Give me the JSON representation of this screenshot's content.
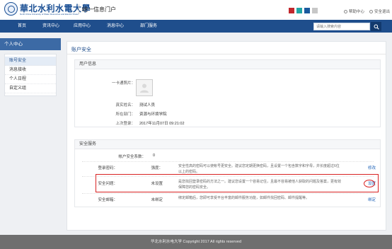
{
  "header": {
    "logo_cn": "華北水利水電大學",
    "logo_en": "North China University of Water Resources and Electric Power",
    "portal_title": "统一信息门户",
    "theme_colors": [
      "#c1272d",
      "#21a6a6",
      "#1a5a9e",
      "#c7c7c7"
    ],
    "help_label": "帮助中心",
    "logout_label": "安全退出"
  },
  "nav": {
    "items": [
      "首页",
      "资讯中心",
      "应用中心",
      "消息中心",
      "部门服务"
    ],
    "search_placeholder": "请输入搜索内容"
  },
  "sidebar": {
    "title": "个人中心",
    "items": [
      "账号安全",
      "消息接收",
      "个人日程",
      "自定义组"
    ],
    "active_index": 0
  },
  "main": {
    "page_title": "账户安全",
    "user_info": {
      "panel_title": "用户信息",
      "photo_label": "一卡通照片：",
      "name_label": "真实姓名：",
      "name_value": "测试人员",
      "dept_label": "所在部门：",
      "dept_value": "资源与环境学院",
      "last_login_label": "上次登录：",
      "last_login_value": "2017年11月07日 09:21:02"
    },
    "security": {
      "panel_title": "安全服务",
      "score_label": "帐户安全系数：",
      "score_value": "0",
      "rows": [
        {
          "label": "登录密码：",
          "status": "强度：",
          "desc": "安全性高的密码可以使帐号更安全。建议您定期更换密码，且设置一个包含数字和字母，并长度超过6位以上的密码。",
          "action": "修改"
        },
        {
          "label": "安全问题：",
          "status": "未设置",
          "desc": "是您找回登录密码的方法之一。建议您设置一个容易记住，且最不容易被他人获取的问题及答案，更有效保障您的密码安全。",
          "action": "设置"
        },
        {
          "label": "安全邮箱：",
          "status": "未绑定",
          "desc": "绑定邮箱后，您即可享受平台丰富的邮件服务功能，如邮件找回密码、邮件提醒等。",
          "action": "绑定"
        }
      ]
    }
  },
  "footer": {
    "text": "华北水利水电大学 Copyright 2017 All rights reserved"
  }
}
